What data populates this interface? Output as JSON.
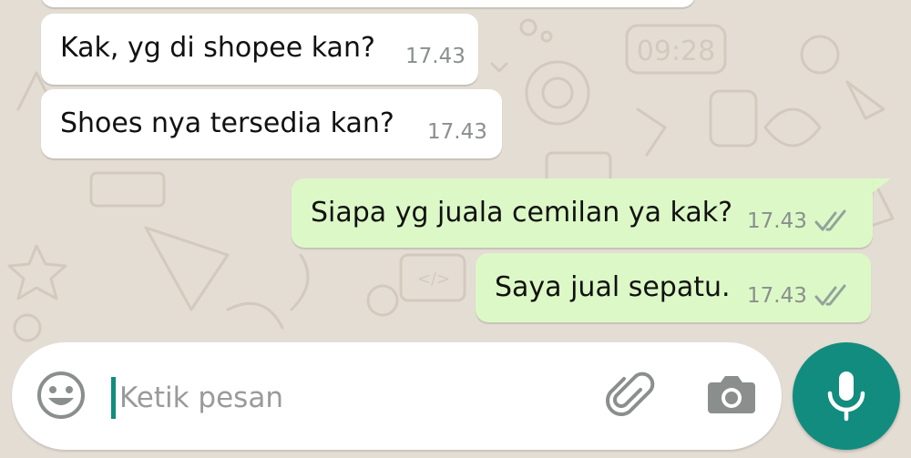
{
  "chat": {
    "messages": [
      {
        "direction": "incoming",
        "text": "Kak, yg di shopee kan?",
        "time": "17.43"
      },
      {
        "direction": "incoming",
        "text": "Shoes nya tersedia kan?",
        "time": "17.43"
      },
      {
        "direction": "outgoing",
        "text": "Siapa yg juala cemilan ya kak?",
        "time": "17.43",
        "status": "delivered-double-check-icon"
      },
      {
        "direction": "outgoing",
        "text": "Saya jual sepatu.",
        "time": "17.43",
        "status": "delivered-double-check-icon"
      }
    ]
  },
  "composer": {
    "placeholder": "Ketik pesan",
    "value": "",
    "icons": [
      "emoji-icon",
      "paperclip-icon",
      "camera-icon",
      "microphone-icon"
    ]
  },
  "colors": {
    "wallpaper": "#e4ddd4",
    "incoming_bubble": "#ffffff",
    "outgoing_bubble": "#dcf8c6",
    "accent": "#128c7e",
    "timestamp": "#8a8f8e"
  }
}
